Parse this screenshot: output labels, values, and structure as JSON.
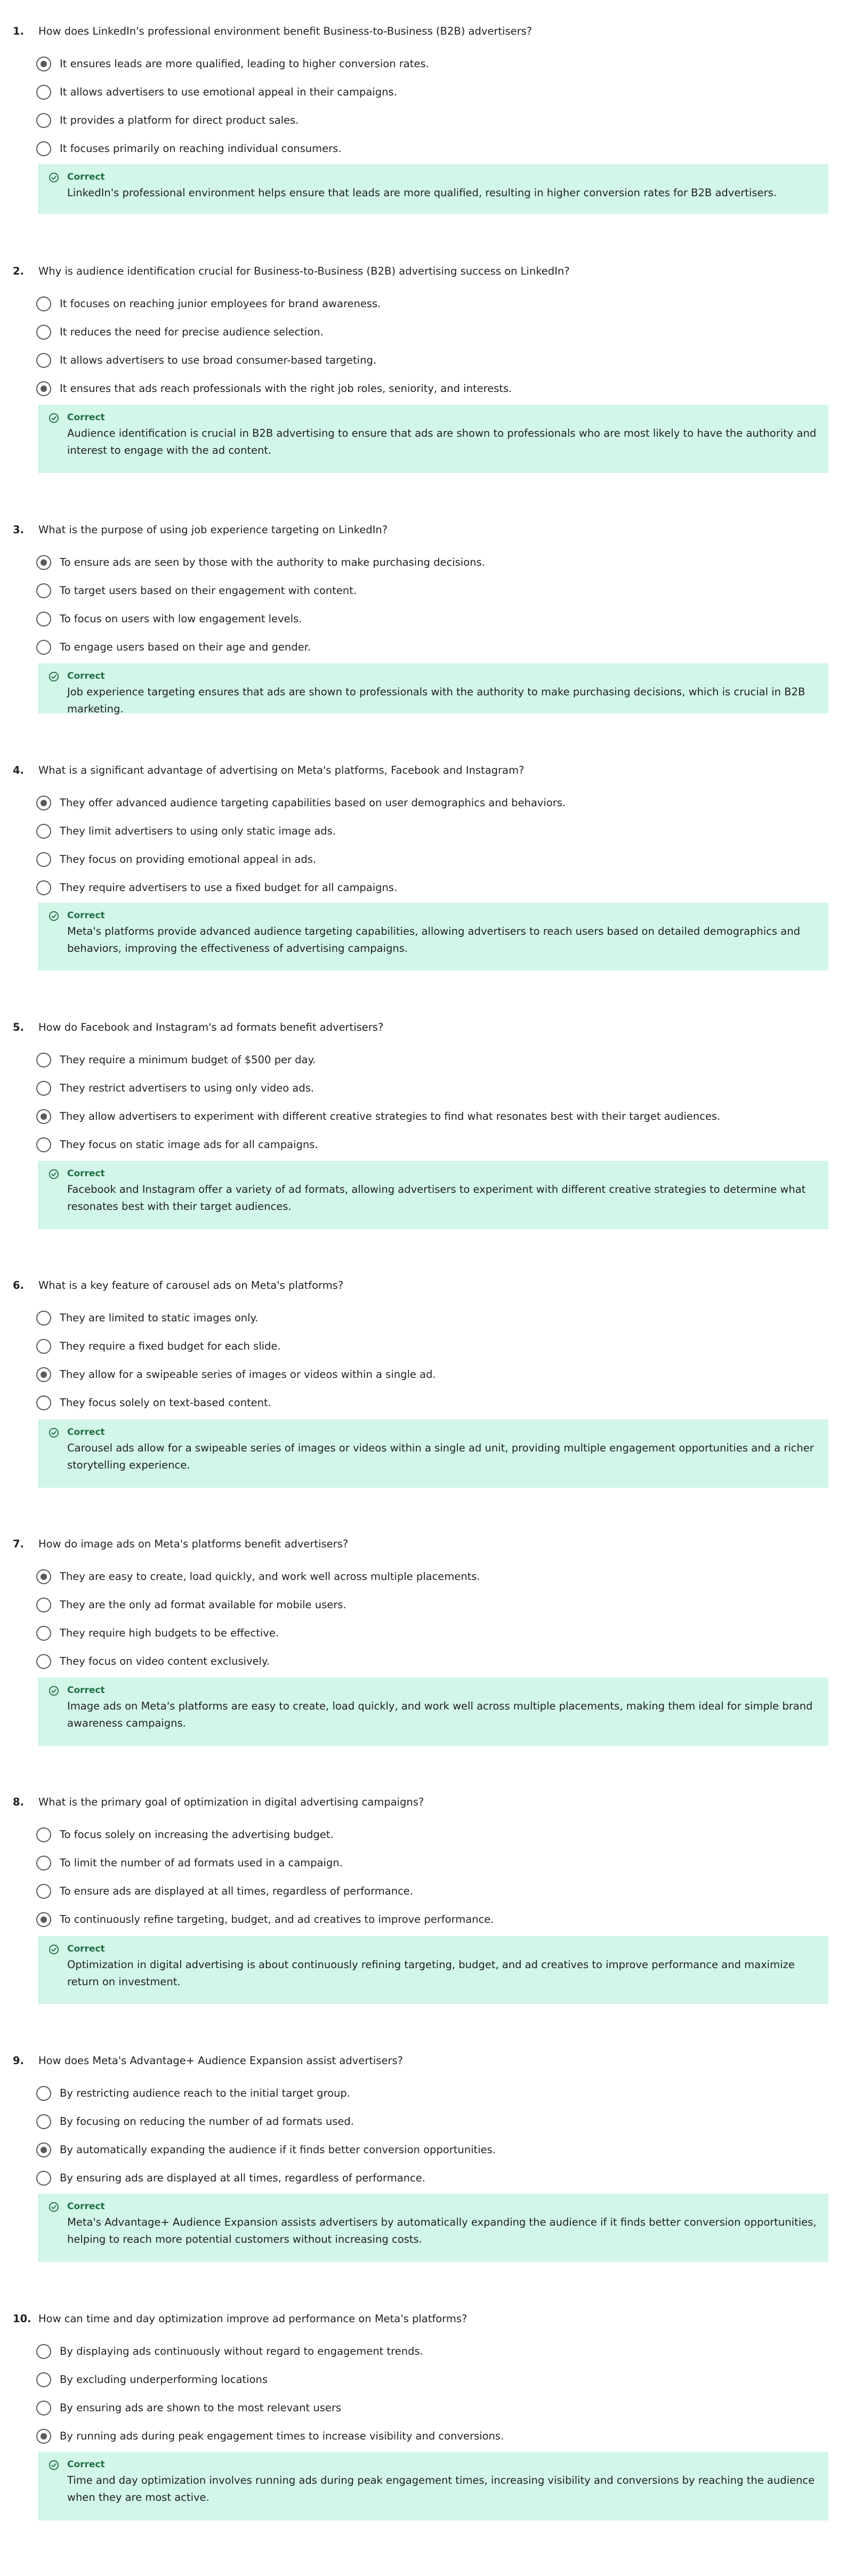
{
  "questions": [
    {
      "number": "1.",
      "text": "How does LinkedIn's professional environment benefit Business-to-Business (B2B) advertisers?",
      "options": [
        "It ensures leads are more qualified, leading to higher conversion rates.",
        "It allows advertisers to use emotional appeal in their campaigns.",
        "It provides a platform for direct product sales.",
        "It focuses primarily on reaching individual consumers."
      ],
      "selected_index": 0,
      "feedback": {
        "status": "Correct",
        "text": "LinkedIn's professional environment helps ensure that leads are more qualified, resulting in higher conversion rates for B2B advertisers."
      }
    },
    {
      "number": "2.",
      "text": "Why is audience identification crucial for Business-to-Business (B2B) advertising success on LinkedIn?",
      "options": [
        "It focuses on reaching junior employees for brand awareness.",
        "It reduces the need for precise audience selection.",
        "It allows advertisers to use broad consumer-based targeting.",
        "It ensures that ads reach professionals with the right job roles, seniority, and interests."
      ],
      "selected_index": 3,
      "feedback": {
        "status": "Correct",
        "text": "Audience identification is crucial in B2B advertising to ensure that ads are shown to professionals who are most likely to have the authority and interest to engage with the ad content."
      }
    },
    {
      "number": "3.",
      "text": "What is the purpose of using job experience targeting on LinkedIn?",
      "options": [
        "To ensure ads are seen by those with the authority to make purchasing decisions.",
        "To target users based on their engagement with content.",
        "To focus on users with low engagement levels.",
        "To engage users based on their age and gender."
      ],
      "selected_index": 0,
      "feedback": {
        "status": "Correct",
        "text": "Job experience targeting ensures that ads are shown to professionals with the authority to make purchasing decisions, which is crucial in B2B marketing."
      }
    },
    {
      "number": "4.",
      "text": "What is a significant advantage of advertising on Meta's platforms, Facebook and Instagram?",
      "options": [
        "They offer advanced audience targeting capabilities based on user demographics and behaviors.",
        "They limit advertisers to using only static image ads.",
        "They focus on providing emotional appeal in ads.",
        "They require advertisers to use a fixed budget for all campaigns."
      ],
      "selected_index": 0,
      "feedback": {
        "status": "Correct",
        "text": "Meta's platforms provide advanced audience targeting capabilities, allowing advertisers to reach users based on detailed demographics and behaviors, improving the effectiveness of advertising campaigns."
      }
    },
    {
      "number": "5.",
      "text": "How do Facebook and Instagram's ad formats benefit advertisers?",
      "options": [
        "They require a minimum budget of $500 per day.",
        "They restrict advertisers to using only video ads.",
        "They allow advertisers to experiment with different creative strategies to find what resonates best with their target audiences.",
        "They focus on static image ads for all campaigns."
      ],
      "selected_index": 2,
      "feedback": {
        "status": "Correct",
        "text": "Facebook and Instagram offer a variety of ad formats, allowing advertisers to experiment with different creative strategies to determine what resonates best with their target audiences."
      }
    },
    {
      "number": "6.",
      "text": "What is a key feature of carousel ads on Meta's platforms?",
      "options": [
        "They are limited to static images only.",
        "They require a fixed budget for each slide.",
        "They allow for a swipeable series of images or videos within a single ad.",
        "They focus solely on text-based content."
      ],
      "selected_index": 2,
      "feedback": {
        "status": "Correct",
        "text": "Carousel ads allow for a swipeable series of images or videos within a single ad unit, providing multiple engagement opportunities and a richer storytelling experience."
      }
    },
    {
      "number": "7.",
      "text": "How do image ads on Meta's platforms benefit advertisers?",
      "options": [
        "They are easy to create, load quickly, and work well across multiple placements.",
        "They are the only ad format available for mobile users.",
        "They require high budgets to be effective.",
        "They focus on video content exclusively."
      ],
      "selected_index": 0,
      "feedback": {
        "status": "Correct",
        "text": "Image ads on Meta's platforms are easy to create, load quickly, and work well across multiple placements, making them ideal for simple brand awareness campaigns."
      }
    },
    {
      "number": "8.",
      "text": "What is the primary goal of optimization in digital advertising campaigns?",
      "options": [
        "To focus solely on increasing the advertising budget.",
        "To limit the number of ad formats used in a campaign.",
        "To ensure ads are displayed at all times, regardless of performance.",
        "To continuously refine targeting, budget, and ad creatives to improve performance."
      ],
      "selected_index": 3,
      "feedback": {
        "status": "Correct",
        "text": "Optimization in digital advertising is about continuously refining targeting, budget, and ad creatives to improve performance and maximize return on investment."
      }
    },
    {
      "number": "9.",
      "text": "How does Meta's Advantage+ Audience Expansion assist advertisers?",
      "options": [
        "By restricting audience reach to the initial target group.",
        "By focusing on reducing the number of ad formats used.",
        "By automatically expanding the audience if it finds better conversion opportunities.",
        "By ensuring ads are displayed at all times, regardless of performance."
      ],
      "selected_index": 2,
      "feedback": {
        "status": "Correct",
        "text": "Meta's Advantage+ Audience Expansion assists advertisers by automatically expanding the audience if it finds better conversion opportunities, helping to reach more potential customers without increasing costs."
      }
    },
    {
      "number": "10.",
      "text": "How can time and day optimization improve ad performance on Meta's platforms?",
      "options": [
        "By displaying ads continuously without regard to engagement trends.",
        "By excluding underperforming locations",
        "By ensuring ads are shown to the most relevant users",
        "By running ads during peak engagement times to increase visibility and conversions."
      ],
      "selected_index": 3,
      "feedback": {
        "status": "Correct",
        "text": "Time and day optimization involves running ads during peak engagement times, increasing visibility and conversions by reaching the audience when they are most active."
      }
    }
  ]
}
